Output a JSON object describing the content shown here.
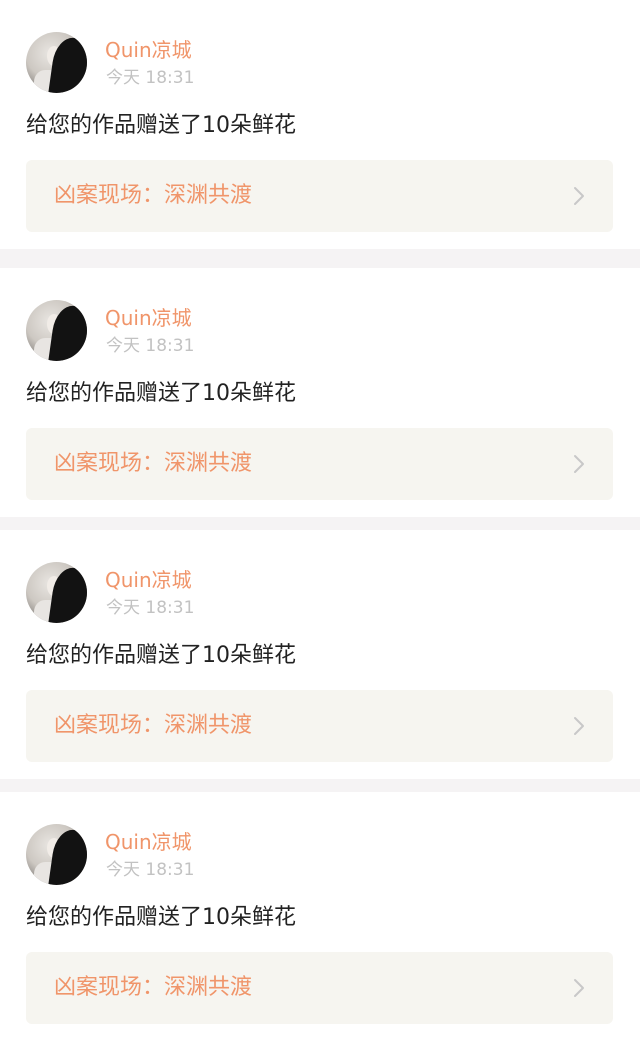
{
  "notifications": [
    {
      "username": "Quin凉城",
      "time": "今天 18:31",
      "message": "给您的作品赠送了10朵鲜花",
      "work_title": "凶案现场：深渊共渡",
      "avatar_icon": "user-avatar",
      "link_icon": "chevron-right-icon"
    },
    {
      "username": "Quin凉城",
      "time": "今天 18:31",
      "message": "给您的作品赠送了10朵鲜花",
      "work_title": "凶案现场：深渊共渡",
      "avatar_icon": "user-avatar",
      "link_icon": "chevron-right-icon"
    },
    {
      "username": "Quin凉城",
      "time": "今天 18:31",
      "message": "给您的作品赠送了10朵鲜花",
      "work_title": "凶案现场：深渊共渡",
      "avatar_icon": "user-avatar",
      "link_icon": "chevron-right-icon"
    },
    {
      "username": "Quin凉城",
      "time": "今天 18:31",
      "message": "给您的作品赠送了10朵鲜花",
      "work_title": "凶案现场：深渊共渡",
      "avatar_icon": "user-avatar",
      "link_icon": "chevron-right-icon"
    }
  ],
  "colors": {
    "accent": "#f0956a",
    "page_background": "#f5f3f4",
    "card_background": "#ffffff",
    "link_background": "#f6f5f0",
    "muted_text": "#c2c2c2",
    "body_text": "#222222",
    "chevron": "#c8c8c8"
  }
}
